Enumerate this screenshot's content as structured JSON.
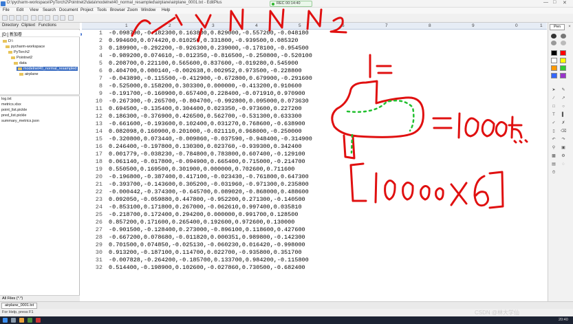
{
  "title": "D:\\pycharm-workspace\\PyTorch2\\Pointnet2\\data\\modelnet40_normal_resampled\\airplane\\airplane_0001.txt - EditPlus",
  "recorder": "REC 00:14:40",
  "menu": [
    "File",
    "Edit",
    "View",
    "Search",
    "Document",
    "Project",
    "Tools",
    "Browser",
    "Zoom",
    "Window",
    "Help"
  ],
  "panel": {
    "tabs": [
      "Directory",
      "Cliptext",
      "Functions"
    ],
    "drive": "[D:] 新加卷",
    "tree": [
      "D:\\",
      "pycharm-workspace",
      "PyTorch2",
      "Pointnet2",
      "data",
      "modelnet40_normal_resampled",
      "airplane"
    ],
    "files": [
      "log.txt",
      "metrics.xlsx",
      "point_list.pickle",
      "pred_list.pickle",
      "summary_metrics.json"
    ],
    "filter": "All Files (*.*)"
  },
  "ruler": [
    "1",
    "2",
    "3",
    "4",
    "5",
    "6",
    "7",
    "8",
    "9",
    "0",
    "1"
  ],
  "lines": [
    "-0.098790,-0.182300,0.163800,0.829000,-0.557200,-0.048180",
    "0.994600,0.074420,0.010250,0.331800,-0.939500,0.085320",
    "0.189900,-0.292200,-0.926300,0.239000,-0.178100,-0.954500",
    "-0.989200,0.074610,-0.012350,-0.816500,-0.250800,-0.520100",
    "0.208700,0.221100,0.565600,0.837600,-0.019280,0.545900",
    "0.404700,0.080140,-0.002638,0.002952,0.973500,-0.228800",
    "-0.043890,-0.115500,-0.412900,-0.672800,0.679900,-0.291600",
    "-0.525000,0.158200,0.303300,0.000000,-0.413200,0.910600",
    "-0.191700,-0.160900,0.657400,0.228400,-0.071910,0.970900",
    "-0.267300,-0.265700,-0.804700,-0.992800,0.095000,0.073630",
    "0.694500,-0.135400,0.304400,0.023350,-0.973600,0.227200",
    "0.186300,-0.376900,0.426500,0.562700,-0.531300,0.633300",
    "-0.661600,-0.193600,0.102400,0.031270,0.768600,-0.638900",
    "0.082098,0.160900,0.201000,-0.021110,0.968000,-0.250000",
    "-0.320800,0.073440,-0.009860,-0.037590,-0.948400,-0.314900",
    "0.246400,-0.197800,0.130300,0.023760,-0.939300,0.342400",
    "0.001779,-0.038230,-0.784800,0.783800,0.607400,-0.129100",
    "0.061140,-0.017800,-0.094900,0.665400,0.715000,-0.214700",
    "0.550500,0.169500,0.301900,0.000000,0.702600,0.711600",
    "-0.196800,-0.387400,0.417100,-0.023430,-0.761800,0.647300",
    "-0.393700,-0.143600,0.305200,-0.031960,-0.971300,0.235800",
    "-0.000442,-0.374300,-0.645700,0.089020,-0.868000,0.488600",
    "0.092050,-0.059880,0.447800,-0.952200,0.271300,-0.140500",
    "-0.853100,0.171800,0.267000,-0.062610,0.997400,0.035810",
    "-0.218700,0.172400,0.294200,0.000000,0.991700,0.128500",
    "0.857200,0.171600,0.265400,0.192600,0.972600,0.130000",
    "-0.901500,-0.128400,0.273000,-0.896100,0.118600,0.427600",
    "-0.667200,0.078680,-0.011820,0.000351,0.989800,-0.142300",
    "0.701500,0.074850,-0.025130,-0.060230,0.016420,-0.998000",
    "0.913200,-0.187100,0.114700,0.022700,-0.935800,0.351700",
    "-0.007828,-0.264200,-0.185700,0.133700,0.984200,-0.115800",
    "0.514400,-0.198900,0.102600,-0.027860,0.730500,-0.682400"
  ],
  "annotations": {
    "columns": [
      "x",
      "y",
      "z",
      "Nx",
      "Ny",
      "Nz"
    ],
    "one": "1 =",
    "eq": "=10000点",
    "shape": "[10000x6]"
  },
  "doc_tab": "airplane_0001.txt",
  "status": "For Help, press F1",
  "palette_title": "Pen",
  "palette_colors": [
    "#000000",
    "#ff0000",
    "#ffffff",
    "#ffff00",
    "#ff9900",
    "#33cc33",
    "#3366ff",
    "#9933cc"
  ],
  "taskbar_time": "20:40",
  "watermark": "CSDN @林大学仙"
}
